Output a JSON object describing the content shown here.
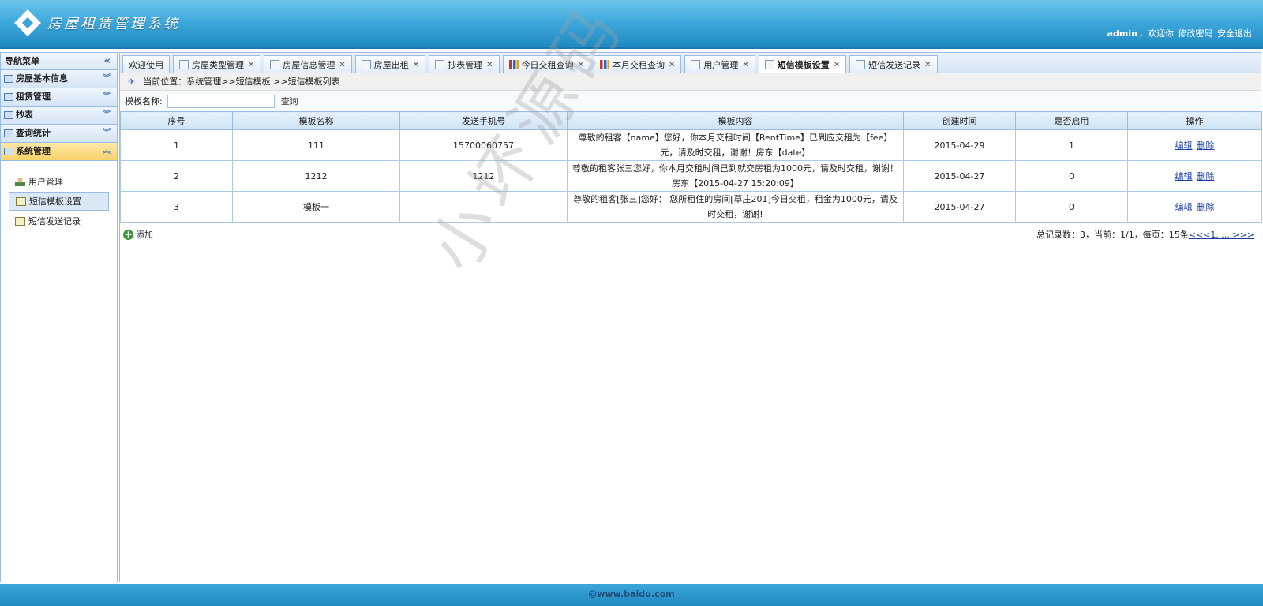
{
  "header": {
    "logo_text": "房屋租赁管理系统",
    "user": "admin",
    "welcome": "，欢迎你",
    "change_password": "修改密码",
    "logout": "安全退出"
  },
  "sidebar": {
    "title": "导航菜单",
    "sections": [
      {
        "label": "房屋基本信息"
      },
      {
        "label": "租赁管理"
      },
      {
        "label": "抄表"
      },
      {
        "label": "查询统计"
      },
      {
        "label": "系统管理"
      }
    ],
    "items": [
      {
        "label": "用户管理"
      },
      {
        "label": "短信模板设置"
      },
      {
        "label": "短信发送记录"
      }
    ]
  },
  "tabs": [
    {
      "label": "欢迎使用"
    },
    {
      "label": "房屋类型管理"
    },
    {
      "label": "房屋信息管理"
    },
    {
      "label": "房屋出租"
    },
    {
      "label": "抄表管理"
    },
    {
      "label": "今日交租查询"
    },
    {
      "label": "本月交租查询"
    },
    {
      "label": "用户管理"
    },
    {
      "label": "短信模板设置"
    },
    {
      "label": "短信发送记录"
    }
  ],
  "breadcrumb": {
    "text": "当前位置：系统管理>>短信模板 >>短信模板列表"
  },
  "search": {
    "label": "模板名称:",
    "value": "",
    "button": "查询"
  },
  "table": {
    "headers": [
      "序号",
      "模板名称",
      "发送手机号",
      "模板内容",
      "创建时间",
      "是否启用",
      "操作"
    ],
    "rows": [
      {
        "no": "1",
        "name": "111",
        "phone": "15700060757",
        "content": "尊敬的租客【name】您好，你本月交租时间【RentTime】已到应交租为【fee】元，请及时交租，谢谢！房东【date】",
        "created": "2015-04-29",
        "enabled": "1"
      },
      {
        "no": "2",
        "name": "1212",
        "phone": "1212",
        "content": "尊敬的租客张三您好，你本月交租时间已到就交房租为1000元，请及时交租，谢谢！房东【2015-04-27 15:20:09】",
        "created": "2015-04-27",
        "enabled": "0"
      },
      {
        "no": "3",
        "name": "模板一",
        "phone": "",
        "content": "尊敬的租客[张三]您好： 您所租住的房间[草庄201]今日交租，租金为1000元，请及时交租，谢谢!",
        "created": "2015-04-27",
        "enabled": "0"
      }
    ],
    "edit_label": "编辑",
    "delete_label": "删除"
  },
  "add_label": "添加",
  "pager": {
    "summary": "总记录数：3，当前：1/1，每页：15条",
    "links": "<<<1......>>>"
  },
  "watermark": "小坏源码",
  "footer": {
    "text": "@www.baidu.com"
  }
}
